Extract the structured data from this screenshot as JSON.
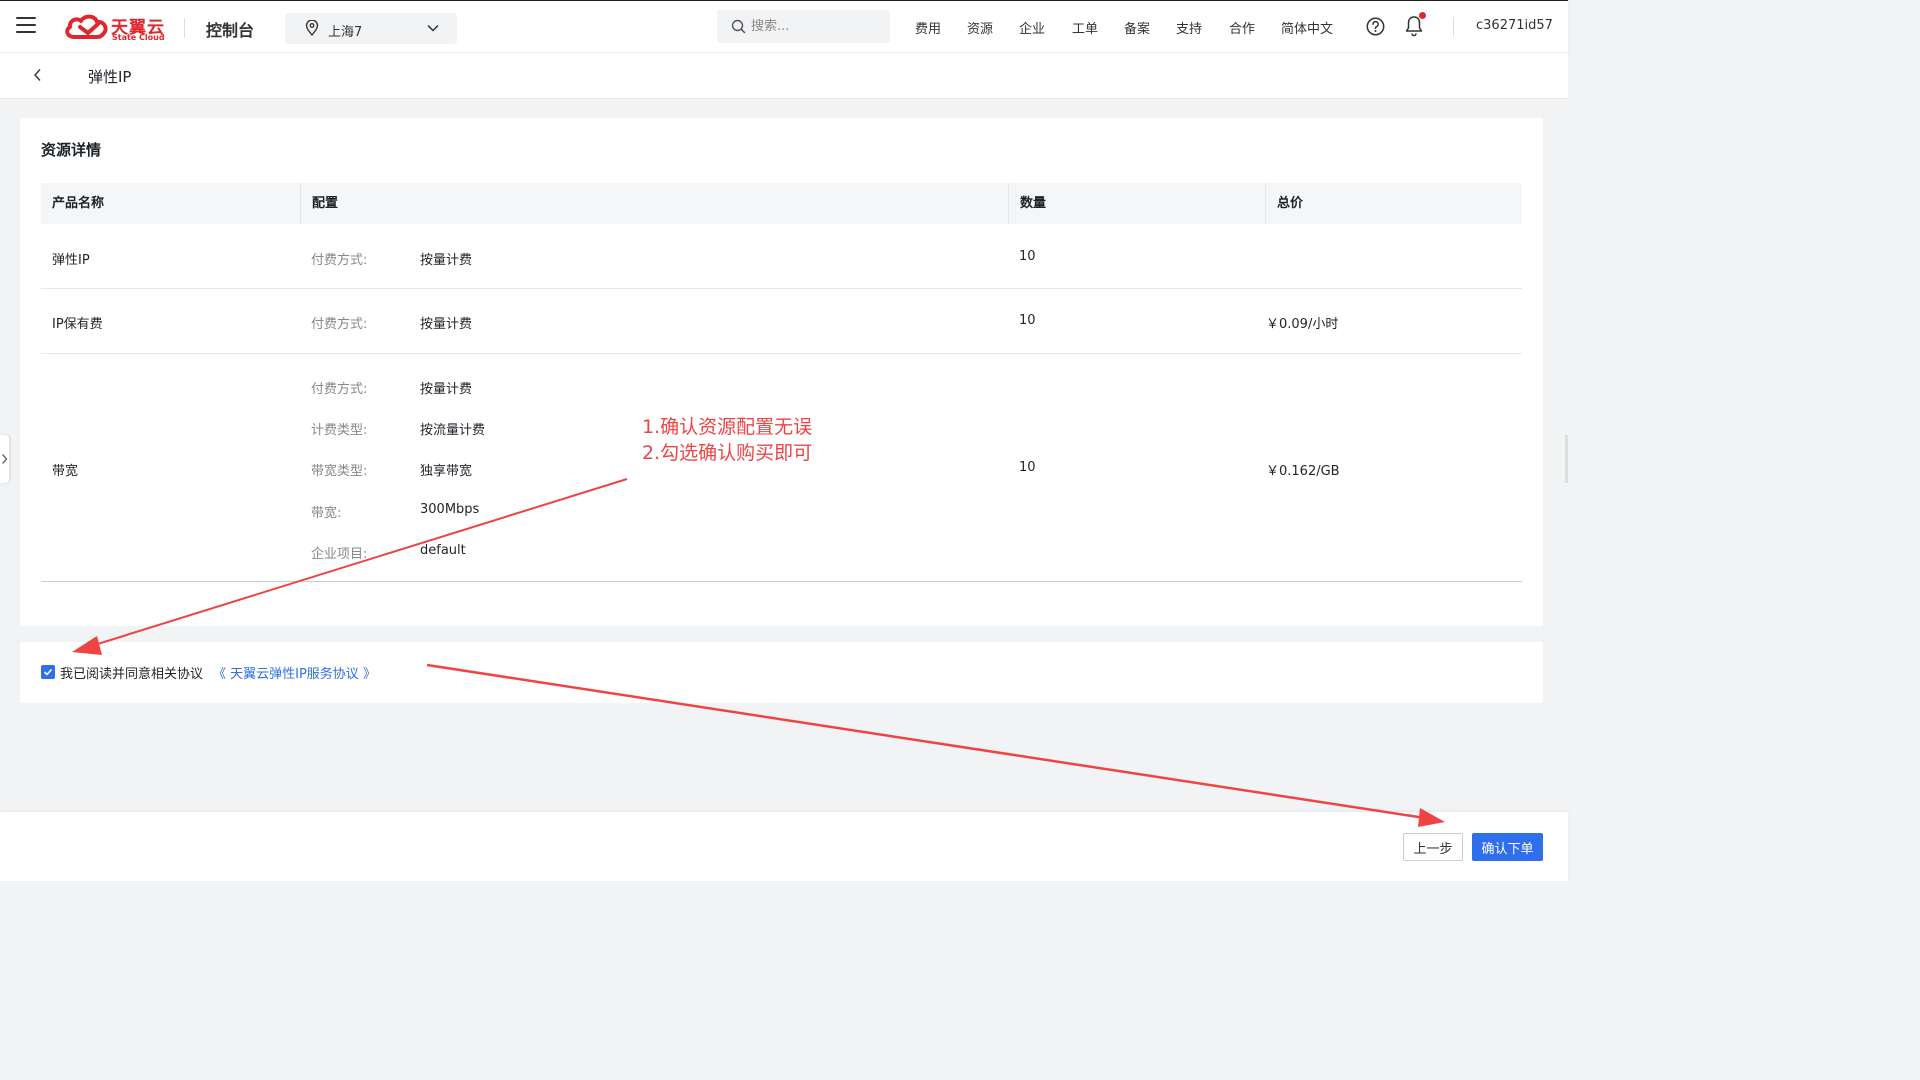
{
  "header": {
    "logo": {
      "cn": "天翼云",
      "en": "State Cloud"
    },
    "console_label": "控制台",
    "region": "上海7",
    "search_placeholder": "搜索...",
    "nav": [
      "费用",
      "资源",
      "企业",
      "工单",
      "备案",
      "支持",
      "合作",
      "简体中文"
    ],
    "user": "c36271id57"
  },
  "page": {
    "title": "弹性IP"
  },
  "resource": {
    "title": "资源详情",
    "columns": [
      "产品名称",
      "配置",
      "数量",
      "总价"
    ],
    "rows": [
      {
        "name": "弹性IP",
        "config": [
          {
            "k": "付费方式:",
            "v": "按量计费"
          }
        ],
        "qty": "10",
        "price": ""
      },
      {
        "name": "IP保有费",
        "config": [
          {
            "k": "付费方式:",
            "v": "按量计费"
          }
        ],
        "qty": "10",
        "price": "￥0.09/小时"
      },
      {
        "name": "带宽",
        "config": [
          {
            "k": "付费方式:",
            "v": "按量计费"
          },
          {
            "k": "计费类型:",
            "v": "按流量计费"
          },
          {
            "k": "带宽类型:",
            "v": "独享带宽"
          },
          {
            "k": "带宽:",
            "v": "300Mbps"
          },
          {
            "k": "企业项目:",
            "v": "default"
          }
        ],
        "qty": "10",
        "price": "￥0.162/GB"
      }
    ]
  },
  "agreement": {
    "checked": true,
    "text": "我已阅读并同意相关协议",
    "link": "《 天翼云弹性IP服务协议 》"
  },
  "footer": {
    "prev": "上一步",
    "confirm": "确认下单"
  },
  "annotation": {
    "line1": "1.确认资源配置无误",
    "line2": "2.勾选确认购买即可"
  },
  "colors": {
    "brand": "#e0262e",
    "primary": "#2f6fea",
    "annotation": "#ef4444"
  },
  "icons": [
    "menu-icon",
    "cloud-logo-icon",
    "location-pin-icon",
    "chevron-down-icon",
    "search-icon",
    "help-icon",
    "bell-icon",
    "chevron-left-icon",
    "chevron-right-icon",
    "check-icon"
  ]
}
